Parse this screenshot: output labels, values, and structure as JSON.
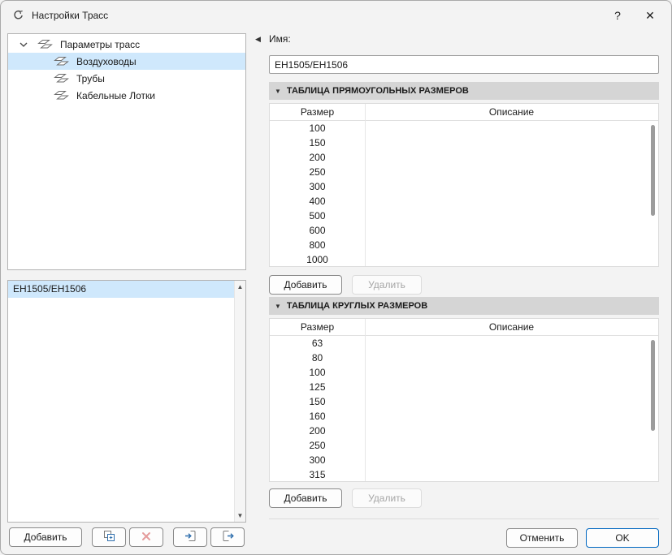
{
  "window": {
    "title": "Настройки Трасс"
  },
  "icons": {
    "help": "?",
    "close": "✕",
    "collapse_left": "◀",
    "section_collapse": "▼",
    "scroll_up": "▲",
    "scroll_down": "▼"
  },
  "tree": {
    "root_label": "Параметры трасс",
    "items": [
      {
        "label": "Воздуховоды",
        "selected": true
      },
      {
        "label": "Трубы",
        "selected": false
      },
      {
        "label": "Кабельные Лотки",
        "selected": false
      }
    ]
  },
  "profile_list": {
    "items": [
      {
        "label": "EH1505/EH1506",
        "selected": true
      }
    ]
  },
  "left_toolbar": {
    "add_label": "Добавить"
  },
  "form": {
    "name_label": "Имя:",
    "name_value": "EH1505/EH1506"
  },
  "sections": [
    {
      "title": "ТАБЛИЦА ПРЯМОУГОЛЬНЫХ РАЗМЕРОВ",
      "columns": [
        "Размер",
        "Описание"
      ],
      "rows": [
        "100",
        "150",
        "200",
        "250",
        "300",
        "400",
        "500",
        "600",
        "800",
        "1000"
      ],
      "add_label": "Добавить",
      "delete_label": "Удалить"
    },
    {
      "title": "ТАБЛИЦА КРУГЛЫХ РАЗМЕРОВ",
      "columns": [
        "Размер",
        "Описание"
      ],
      "rows": [
        "63",
        "80",
        "100",
        "125",
        "150",
        "160",
        "200",
        "250",
        "300",
        "315"
      ],
      "add_label": "Добавить",
      "delete_label": "Удалить"
    }
  ],
  "footer": {
    "cancel_label": "Отменить",
    "ok_label": "OK"
  },
  "colors": {
    "selection_bg": "#cfe8fc",
    "accent": "#0067c0",
    "section_header_bg": "#d5d5d5",
    "delete_icon": "#e59c9c"
  }
}
